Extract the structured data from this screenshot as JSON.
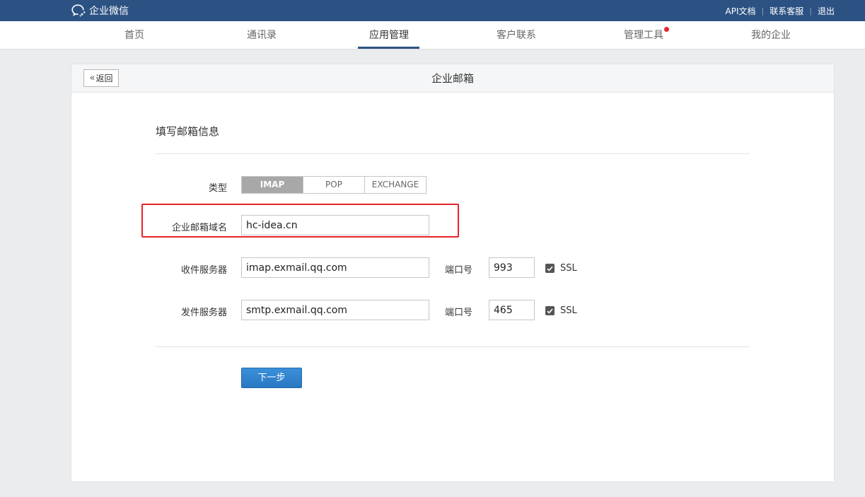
{
  "brand": {
    "name": "企业微信",
    "icon": "chat-bubble-logo-icon"
  },
  "top_links": [
    "API文档",
    "联系客服",
    "退出"
  ],
  "nav": {
    "items": [
      {
        "label": "首页"
      },
      {
        "label": "通讯录"
      },
      {
        "label": "应用管理",
        "active": true
      },
      {
        "label": "客户联系"
      },
      {
        "label": "管理工具",
        "badge_dot": true
      },
      {
        "label": "我的企业"
      }
    ]
  },
  "card": {
    "title": "企业邮箱",
    "back_label": "返回",
    "section_title": "填写邮箱信息",
    "type": {
      "label": "类型",
      "options": [
        "IMAP",
        "POP",
        "EXCHANGE"
      ],
      "selected": "IMAP"
    },
    "domain": {
      "label": "企业邮箱域名",
      "value": "hc-idea.cn"
    },
    "incoming": {
      "label": "收件服务器",
      "value": "imap.exmail.qq.com",
      "port_label": "端口号",
      "port": "993",
      "ssl_label": "SSL",
      "ssl_checked": true
    },
    "outgoing": {
      "label": "发件服务器",
      "value": "smtp.exmail.qq.com",
      "port_label": "端口号",
      "port": "465",
      "ssl_label": "SSL",
      "ssl_checked": true
    },
    "next_label": "下一步"
  },
  "colors": {
    "topbar": "#2c5283",
    "primary_button": "#2a78c3",
    "highlight_box": "#e8232a",
    "nav_badge": "#e6252e"
  }
}
